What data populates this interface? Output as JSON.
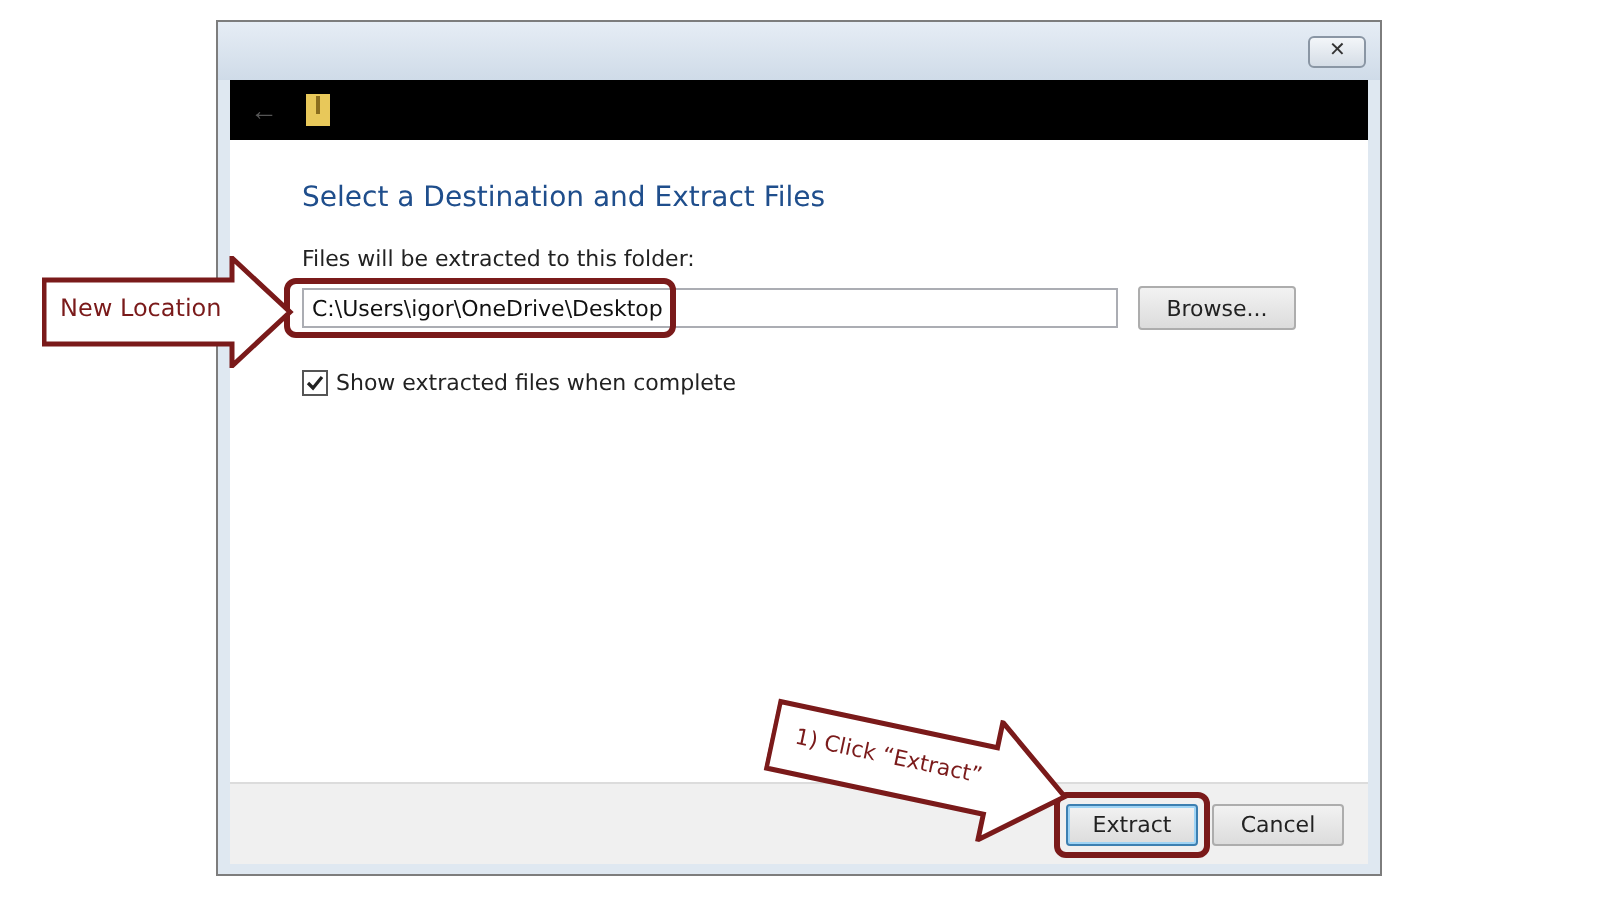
{
  "window": {
    "close_button": "✕"
  },
  "toolbar": {
    "back_button": "←"
  },
  "heading": "Select a Destination and Extract Files",
  "folder_label": "Files will be extracted to this folder:",
  "path_field": {
    "value": "C:\\Users\\igor\\OneDrive\\Desktop",
    "highlighted": true
  },
  "browse_button": "Browse...",
  "show_files": {
    "label": "Show extracted files when complete",
    "checked": true
  },
  "buttons": [
    {
      "label": "Extract",
      "default": true,
      "highlighted": true
    },
    {
      "label": "Cancel",
      "default": false,
      "highlighted": false
    }
  ],
  "callouts": [
    {
      "kind": "straight",
      "text": "New Location"
    },
    {
      "kind": "tilted",
      "text": "1) Click “Extract”"
    }
  ]
}
